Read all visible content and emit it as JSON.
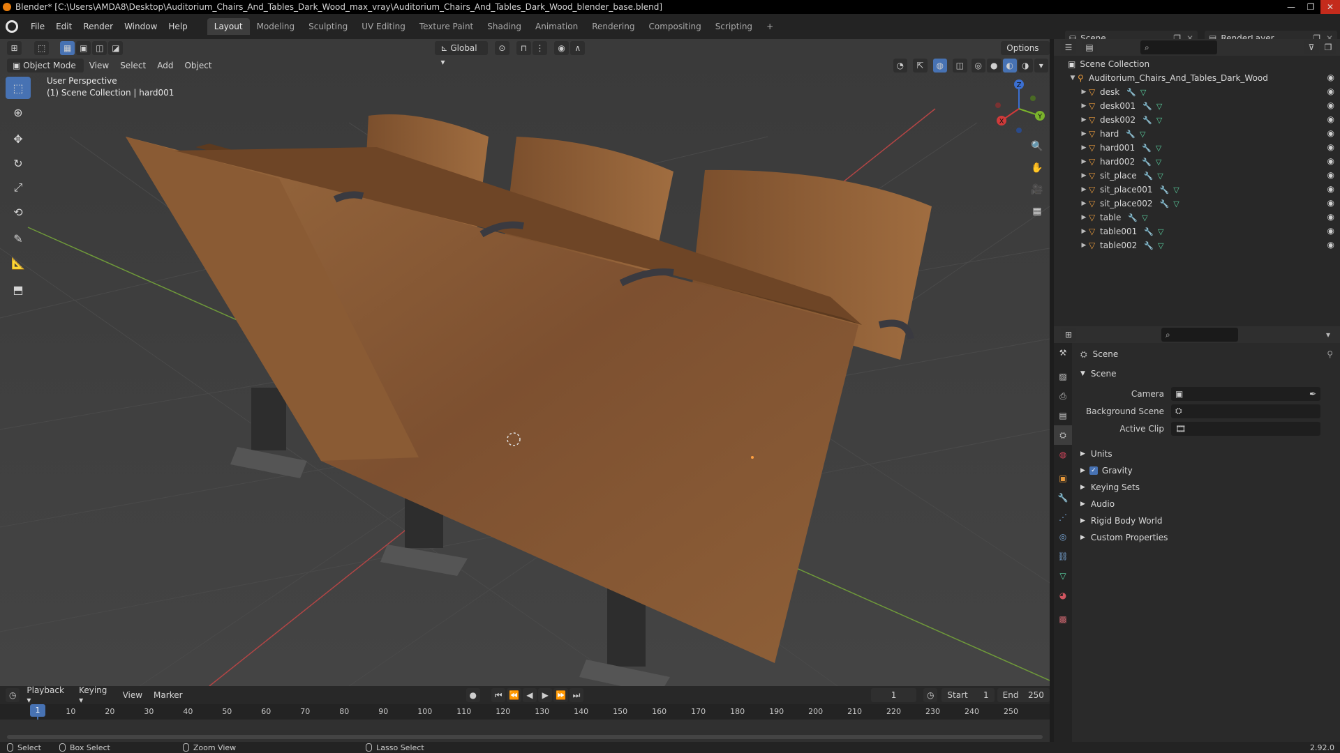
{
  "window": {
    "title": "Blender* [C:\\Users\\AMDA8\\Desktop\\Auditorium_Chairs_And_Tables_Dark_Wood_max_vray\\Auditorium_Chairs_And_Tables_Dark_Wood_blender_base.blend]",
    "controls": [
      "—",
      "❐",
      "✕"
    ]
  },
  "menubar": {
    "items": [
      "File",
      "Edit",
      "Render",
      "Window",
      "Help"
    ]
  },
  "workspaces": {
    "tabs": [
      "Layout",
      "Modeling",
      "Sculpting",
      "UV Editing",
      "Texture Paint",
      "Shading",
      "Animation",
      "Rendering",
      "Compositing",
      "Scripting"
    ],
    "active": "Layout",
    "add": "+"
  },
  "scene_selector": {
    "value": "Scene"
  },
  "renderlayer_selector": {
    "value": "RenderLayer"
  },
  "viewport": {
    "mode": "Object Mode",
    "menus": [
      "View",
      "Select",
      "Add",
      "Object"
    ],
    "transform_orientation": "Global",
    "options": "Options",
    "info_line1": "User Perspective",
    "info_line2": "(1) Scene Collection | hard001",
    "gizmo": {
      "z": "Z",
      "y": "Y",
      "x": "X"
    }
  },
  "outliner": {
    "root": "Scene Collection",
    "collection": "Auditorium_Chairs_And_Tables_Dark_Wood",
    "objects": [
      "desk",
      "desk001",
      "desk002",
      "hard",
      "hard001",
      "hard002",
      "sit_place",
      "sit_place001",
      "sit_place002",
      "table",
      "table001",
      "table002"
    ]
  },
  "properties": {
    "breadcrumb": "Scene",
    "panel": "Scene",
    "fields": [
      {
        "label": "Camera",
        "value": ""
      },
      {
        "label": "Background Scene",
        "value": ""
      },
      {
        "label": "Active Clip",
        "value": ""
      }
    ],
    "sections": [
      "Units",
      "Gravity",
      "Keying Sets",
      "Audio",
      "Rigid Body World",
      "Custom Properties"
    ],
    "gravity_checked": true
  },
  "timeline": {
    "menus": [
      "Playback",
      "Keying",
      "View",
      "Marker"
    ],
    "current_frame": "1",
    "start_label": "Start",
    "start": "1",
    "end_label": "End",
    "end": "250",
    "ticks": [
      "1",
      "10",
      "20",
      "30",
      "40",
      "50",
      "60",
      "70",
      "80",
      "90",
      "100",
      "110",
      "120",
      "130",
      "140",
      "150",
      "160",
      "170",
      "180",
      "190",
      "200",
      "210",
      "220",
      "230",
      "240",
      "250"
    ]
  },
  "statusbar": {
    "select": "Select",
    "box_select": "Box Select",
    "zoom_view": "Zoom View",
    "lasso_select": "Lasso Select",
    "version": "2.92.0"
  },
  "colors": {
    "accent": "#4772b3",
    "object": "#e89a3c",
    "wood": "#8a5a32"
  }
}
